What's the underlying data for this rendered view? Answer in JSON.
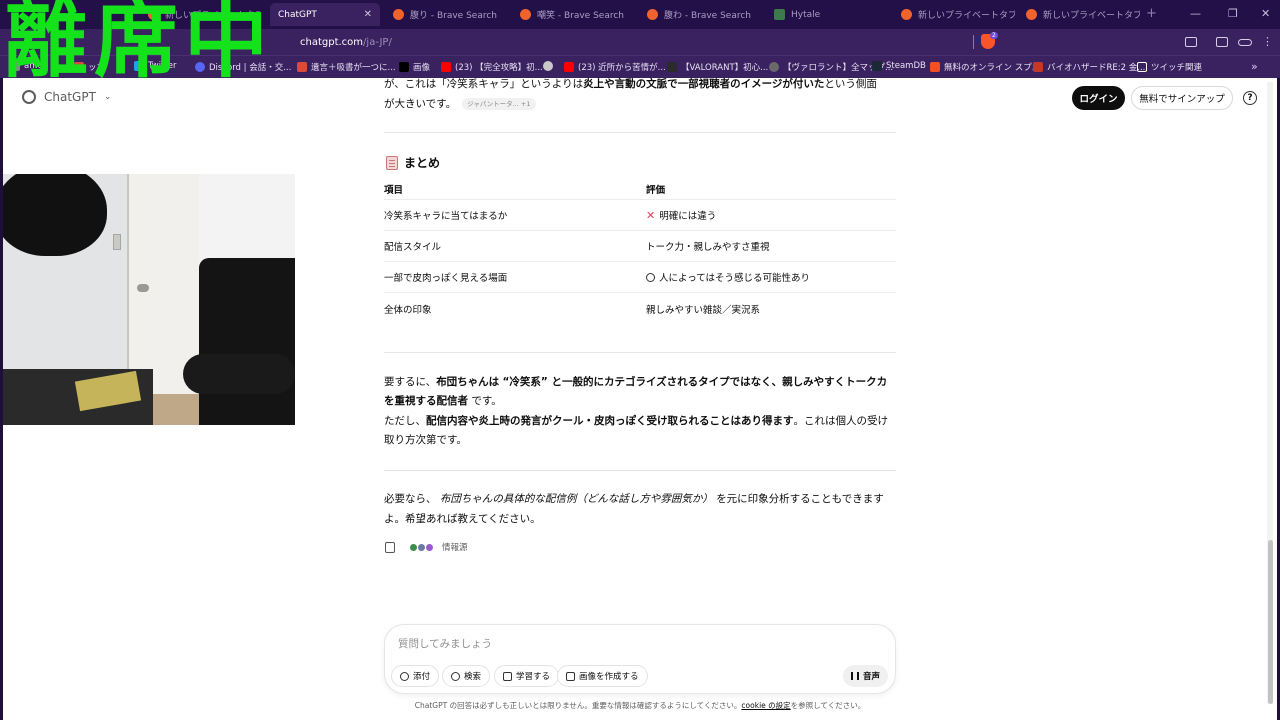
{
  "browser": {
    "tabs": [
      {
        "title": "新しいプライベートタブ",
        "active": false,
        "favicon_color": "#f0632d"
      },
      {
        "title": "ChatGPT",
        "active": true,
        "favicon_color": "#3a2160"
      },
      {
        "title": "腹り - Brave Search",
        "active": false,
        "favicon_color": "#f0632d"
      },
      {
        "title": "嘲笑 - Brave Search",
        "active": false,
        "favicon_color": "#f0632d"
      },
      {
        "title": "腹わ - Brave Search",
        "active": false,
        "favicon_color": "#f0632d"
      },
      {
        "title": "Hytale",
        "active": false,
        "favicon_color": "#3c7a4d"
      },
      {
        "title": "新しいプライベートタブ",
        "active": false,
        "favicon_color": "#f0632d"
      },
      {
        "title": "新しいプライベートタブ",
        "active": false,
        "favicon_color": "#f0632d"
      }
    ],
    "url_host": "chatgpt.com",
    "url_path": "/ja-JP/",
    "shield_count": "2",
    "bookmarks": [
      {
        "label": "ame",
        "color": "#888888"
      },
      {
        "label": "ップ",
        "color": "#d94a3a"
      },
      {
        "label": "Twitter",
        "color": "#1da1f2"
      },
      {
        "label": "Discord | 会話・交...",
        "color": "#5865f2"
      },
      {
        "label": "遺言＋吸書が一つに...",
        "color": "#d94a3a"
      },
      {
        "label": "画像",
        "color": "#000000"
      },
      {
        "label": "(23) 【完全攻略】初...",
        "color": "#ff0000"
      },
      {
        "label": "",
        "color": "#c9c9c9"
      },
      {
        "label": "(23) 近所から苦情が...",
        "color": "#ff0000"
      },
      {
        "label": "【VALORANT】初心...",
        "color": "#2b2b2b"
      },
      {
        "label": "【ヴァロラント】全マップ...",
        "color": "#6a6a6a"
      },
      {
        "label": "SteamDB",
        "color": "#1b2838"
      },
      {
        "label": "無料のオンライン スプ...",
        "color": "#f25022"
      },
      {
        "label": "バイオハザードRE:2 金...",
        "color": "#c0392b"
      },
      {
        "label": "ツイッチ関連",
        "color": "#ffffff"
      }
    ]
  },
  "overlay": {
    "away_text": "離席中"
  },
  "header": {
    "brand": "ChatGPT",
    "login": "ログイン",
    "signup": "無料でサインアップ",
    "help": "?"
  },
  "content": {
    "intro_line1_a": "が、これは「冷笑系キャラ」というよりは",
    "intro_line1_b": "炎上や言動の文脈で一部視聴者のイメージが付いた",
    "intro_line1_c": "という側面",
    "intro_line2": "が大きいです。",
    "intro_cite": "ジャパントータ...",
    "intro_cite_more": "+1",
    "summary_title": "まとめ",
    "table": {
      "headers": [
        "項目",
        "評価"
      ],
      "rows": [
        {
          "item": "冷笑系キャラに当てはまるか",
          "eval": "明確には違う",
          "mark": "x"
        },
        {
          "item": "配信スタイル",
          "eval": "トーク力・親しみやすさ重視",
          "mark": ""
        },
        {
          "item": "一部で皮肉っぽく見える場面",
          "eval": "人によってはそう感じる可能性あり",
          "mark": "o"
        },
        {
          "item": "全体の印象",
          "eval": "親しみやすい雑談／実況系",
          "mark": ""
        }
      ]
    },
    "conclusion_l1_a": "要するに、",
    "conclusion_l1_b": "布団ちゃんは",
    "conclusion_l1_c": "“冷笑系” と一般的にカテゴライズされるタイプではなく、親しみやすくトークカ",
    "conclusion_l2_a": "を重視する配信者",
    "conclusion_l2_b": "です。",
    "conclusion_l3_a": "ただし、",
    "conclusion_l3_b": "配信内容や炎上時の発言がクール・皮肉っぽく受け取られることはあり得ます",
    "conclusion_l3_c": "。これは個人の受け",
    "conclusion_l4": "取り方次第です。",
    "offer_l1_a": "必要なら、",
    "offer_l1_b": "布団ちゃんの具体的な配信例（どんな話し方や雰囲気か）",
    "offer_l1_c": "を元に印象分析することもできます",
    "offer_l2": "よ。希望あれば教えてください。",
    "sources_label": "情報源"
  },
  "composer": {
    "placeholder": "質問してみましょう",
    "attach": "添付",
    "search": "検索",
    "study": "学習する",
    "image": "画像を作成する",
    "voice": "音声"
  },
  "footer": {
    "note_a": "ChatGPT の回答は必ずしも正しいとは限りません。重要な情報は確認するようにしてください。",
    "note_link": "cookie の設定",
    "note_b": "を参照してください。"
  },
  "colors": {
    "chrome_bg": "#241048",
    "chrome_bar": "#3a2160",
    "away_green": "#14e31c",
    "accent_dark": "#0d0d0d"
  }
}
